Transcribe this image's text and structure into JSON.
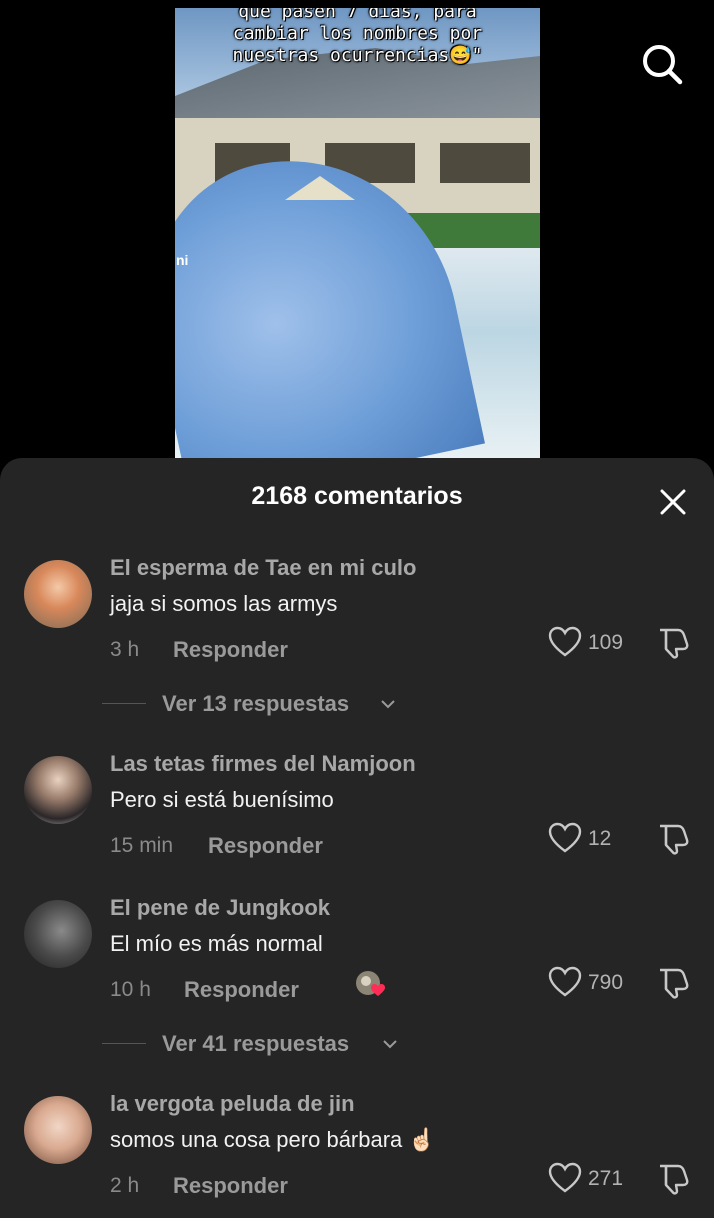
{
  "video": {
    "caption_line1": "que pasen 7 días, para",
    "caption_line2": "cambiar los nombres por",
    "caption_line3": "nuestras ocurrencias😅\"",
    "side_label": "ni"
  },
  "header": {
    "search_icon": "search-icon"
  },
  "sheet": {
    "title": "2168 comentarios",
    "close_icon": "close-icon"
  },
  "comments": [
    {
      "username": "El esperma de Tae en mi  culo",
      "text": "jaja si somos las armys",
      "time": "3 h",
      "reply": "Responder",
      "likes": "109"
    },
    {
      "username": "Las tetas firmes del Namjoon",
      "text": "Pero si está buenísimo",
      "time": "15 min",
      "reply": "Responder",
      "likes": "12"
    },
    {
      "username": "El pene de Jungkook",
      "text": "El mío es más normal",
      "time": "10 h",
      "reply": "Responder",
      "likes": "790"
    },
    {
      "username": "la vergota peluda de jin",
      "text": "somos una cosa pero bárbara ☝🏻",
      "time": "2 h",
      "reply": "Responder",
      "likes": "271"
    }
  ],
  "view_replies": [
    {
      "label": "Ver 13 respuestas"
    },
    {
      "label": "Ver 41 respuestas"
    }
  ],
  "colors": {
    "sheet_bg": "#252525",
    "username": "#a8a8a8",
    "text": "#f2f2f2",
    "muted": "#8a8a8a"
  }
}
